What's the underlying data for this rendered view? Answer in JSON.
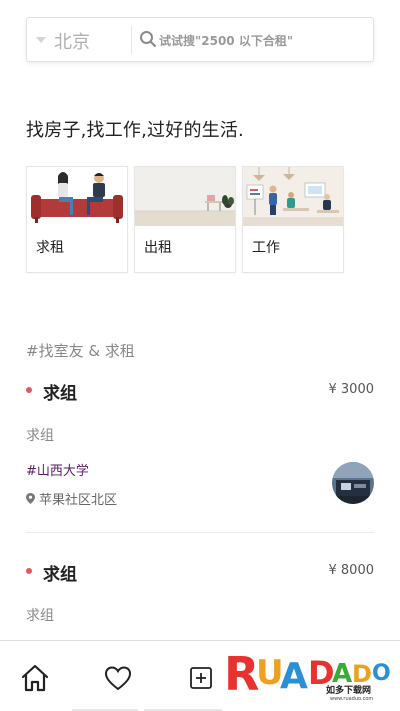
{
  "search": {
    "city": "北京",
    "placeholder": "试试搜\"2500 以下合租\"",
    "icons": {
      "dropdown": "triangle-down",
      "search": "magnifier"
    }
  },
  "tagline": "找房子,找工作,过好的生活.",
  "categories": [
    {
      "label": "求租",
      "icon": "sofa-people-illustration"
    },
    {
      "label": "出租",
      "icon": "room-illustration"
    },
    {
      "label": "工作",
      "icon": "office-illustration"
    }
  ],
  "section": {
    "title": "#找室友 & 求租"
  },
  "posts": [
    {
      "title": "求组",
      "price": "¥ 3000",
      "desc": "求组",
      "tag": "#山西大学",
      "location": "苹果社区北区"
    },
    {
      "title": "求组",
      "price": "¥ 8000",
      "desc": "求组"
    }
  ],
  "tabbar": {
    "icons": [
      "home-icon",
      "heart-icon",
      "add-icon"
    ]
  },
  "watermark": {
    "brand": "RUADADO",
    "sub": "如多下载网",
    "url": "www.ruaduo.com"
  },
  "colors": {
    "accent_dot": "#e9545b",
    "tag": "#5a1a66",
    "watermark_red": "#e8322d"
  }
}
